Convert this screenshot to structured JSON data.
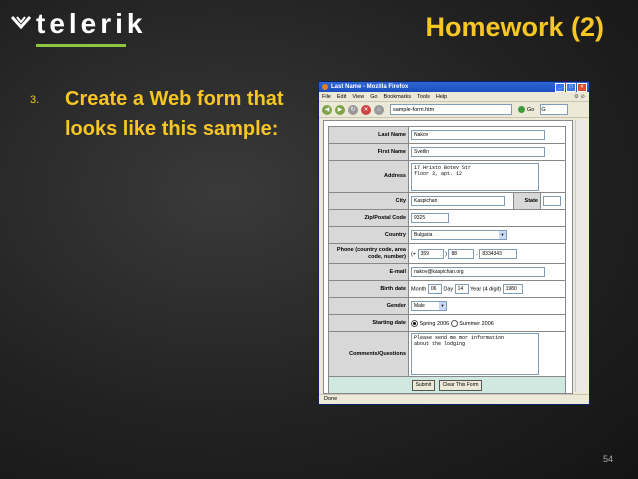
{
  "brand": {
    "logo_text": "telerik",
    "accent": "#8dc63f"
  },
  "slide": {
    "title": "Homework (2)",
    "bullet_number": "3.",
    "bullet_text": "Create a Web form that looks like this sample:",
    "page_number": "54",
    "title_color": "#f6c624"
  },
  "browser": {
    "window_title": "Last Name - Mozilla Firefox",
    "menu": [
      "File",
      "Edit",
      "View",
      "Go",
      "Bookmarks",
      "Tools",
      "Help"
    ],
    "url": "sample-form.htm",
    "go_label": "Go",
    "status": "Done"
  },
  "form": {
    "last_name_label": "Last Name",
    "last_name": "Nakov",
    "first_name_label": "First Name",
    "first_name": "Svetlin",
    "address_label": "Address",
    "address": "17 Hristo Botev Str\nfloor 3, apt. 12",
    "city_label": "City",
    "city": "Kaspichan",
    "state_label": "State",
    "state": "",
    "zip_label": "Zip/Postal Code",
    "zip": "9325",
    "country_label": "Country",
    "country": "Bulgaria",
    "phone_label": "Phone (country code, area code, number)",
    "phone_plus": "(+",
    "phone_country": "359",
    "phone_paren": ")",
    "phone_area": "88",
    "phone_dash": "-",
    "phone_number": "8334343",
    "email_label": "E-mail",
    "email": "nakov@kaspichan.org",
    "birth_label": "Birth date",
    "month_label": "Month",
    "month": "06",
    "day_label": "Day",
    "day": "14",
    "year_label": "Year (4 digit)",
    "year": "1980",
    "gender_label": "Gender",
    "gender": "Male",
    "start_label": "Starting date",
    "start_opt1": "Spring 2006",
    "start_opt2": "Summer 2006",
    "comments_label": "Comments/Questions",
    "comments": "Please send me mor information\nabout the lodging",
    "submit_label": "Submit",
    "clear_label": "Clear This Form"
  }
}
